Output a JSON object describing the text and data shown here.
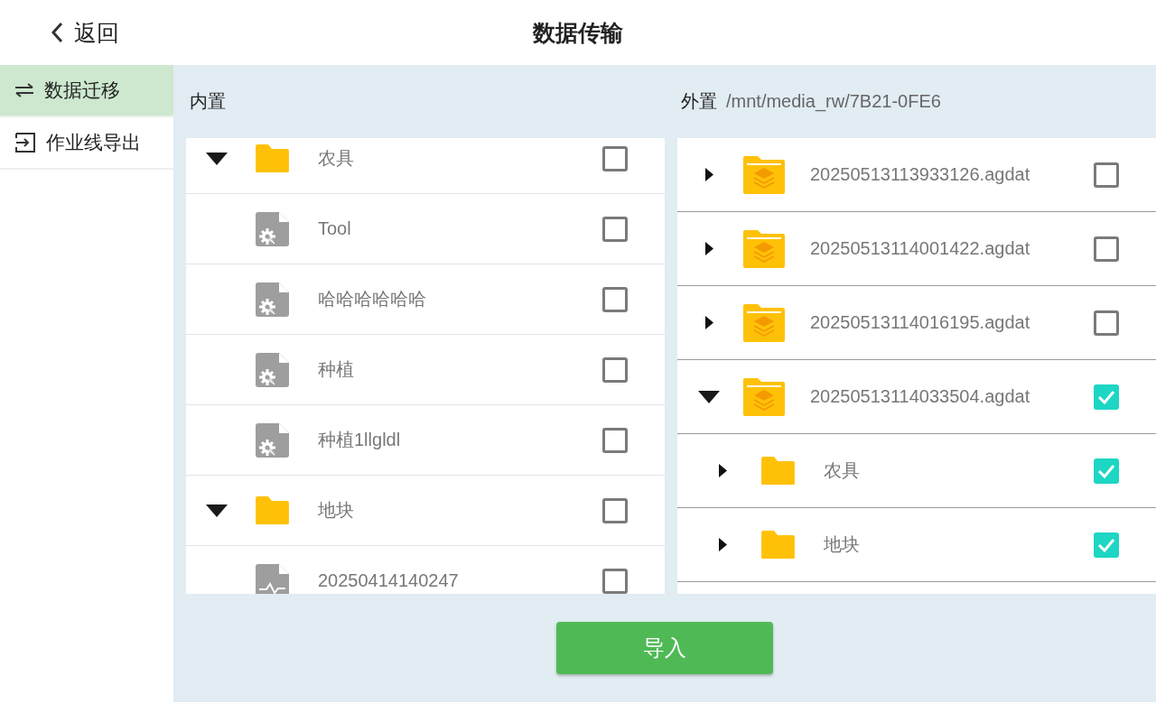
{
  "header": {
    "back_label": "返回",
    "title": "数据传输"
  },
  "sidebar": {
    "items": [
      {
        "label": "数据迁移",
        "kind": "swap",
        "selected": true
      },
      {
        "label": "作业线导出",
        "kind": "export",
        "selected": false
      }
    ]
  },
  "internal_panel": {
    "label": "内置",
    "items": [
      {
        "name": "农具",
        "kind": "folder",
        "expanded": true,
        "checked": false,
        "children": [
          {
            "name": "Tool",
            "kind": "tool_file",
            "checked": false
          },
          {
            "name": "哈哈哈哈哈哈",
            "kind": "tool_file",
            "checked": false
          },
          {
            "name": "种植",
            "kind": "tool_file",
            "checked": false
          },
          {
            "name": "种植1llgldl",
            "kind": "tool_file",
            "checked": false
          }
        ]
      },
      {
        "name": "地块",
        "kind": "folder",
        "expanded": true,
        "checked": false,
        "children": [
          {
            "name": "20250414140247",
            "kind": "track_file",
            "checked": false
          }
        ]
      }
    ]
  },
  "external_panel": {
    "label": "外置",
    "path": "/mnt/media_rw/7B21-0FE6",
    "items": [
      {
        "name": "20250513113933126.agdat",
        "kind": "data_folder",
        "expanded": false,
        "checked": false
      },
      {
        "name": "20250513114001422.agdat",
        "kind": "data_folder",
        "expanded": false,
        "checked": false
      },
      {
        "name": "20250513114016195.agdat",
        "kind": "data_folder",
        "expanded": false,
        "checked": false
      },
      {
        "name": "20250513114033504.agdat",
        "kind": "data_folder",
        "expanded": true,
        "checked": true,
        "children": [
          {
            "name": "农具",
            "kind": "folder",
            "expanded": false,
            "checked": true
          },
          {
            "name": "地块",
            "kind": "folder",
            "expanded": false,
            "checked": true
          }
        ]
      }
    ]
  },
  "import_button": "导入"
}
